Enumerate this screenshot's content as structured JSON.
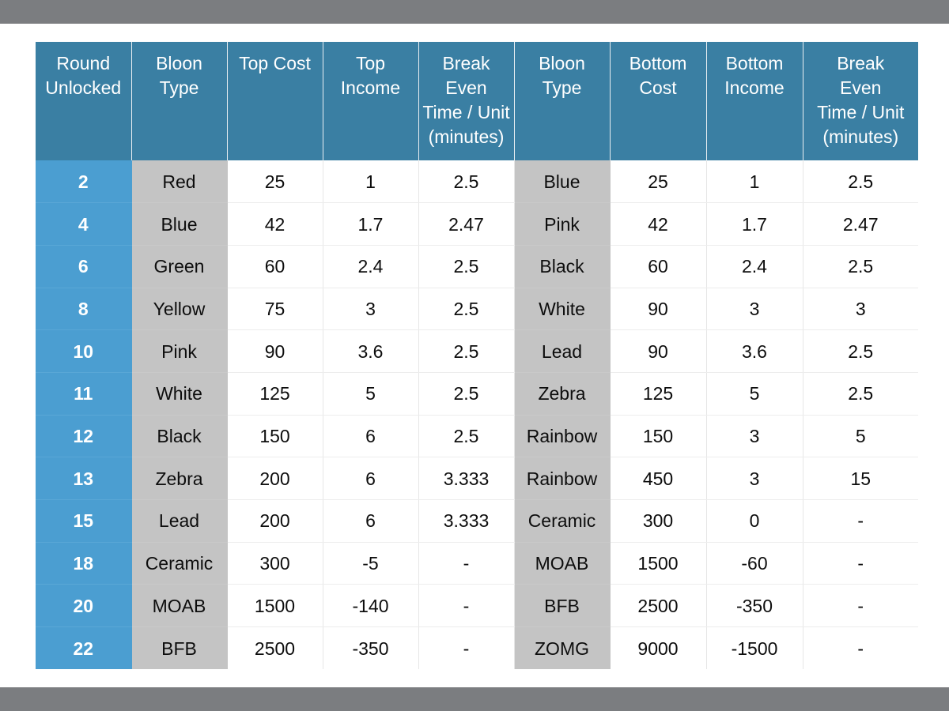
{
  "colors": {
    "header_blue": "#3a7fa3",
    "round_blue": "#4b9ed1",
    "bloon_gray": "#c4c4c4",
    "bar_gray": "#7b7d80",
    "cell_white": "#ffffff",
    "text_dark": "#0d0d0d",
    "text_light": "#ffffff"
  },
  "table": {
    "headers": [
      "Round Unlocked",
      "Bloon Type",
      "Top Cost",
      "Top Income",
      "Break Even Time / Unit (minutes)",
      "Bloon Type",
      "Bottom Cost",
      "Bottom Income",
      "Break Even Time / Unit (minutes)"
    ],
    "header_lines": [
      [
        "Round",
        "Unlocked"
      ],
      [
        "Bloon",
        "Type"
      ],
      [
        "Top Cost"
      ],
      [
        "Top",
        "Income"
      ],
      [
        "Break",
        "Even",
        "Time / Unit",
        "(minutes)"
      ],
      [
        "Bloon",
        "Type"
      ],
      [
        "Bottom",
        "Cost"
      ],
      [
        "Bottom",
        "Income"
      ],
      [
        "Break",
        "Even",
        "Time / Unit",
        "(minutes)"
      ]
    ],
    "rows": [
      [
        "2",
        "Red",
        "25",
        "1",
        "2.5",
        "Blue",
        "25",
        "1",
        "2.5"
      ],
      [
        "4",
        "Blue",
        "42",
        "1.7",
        "2.47",
        "Pink",
        "42",
        "1.7",
        "2.47"
      ],
      [
        "6",
        "Green",
        "60",
        "2.4",
        "2.5",
        "Black",
        "60",
        "2.4",
        "2.5"
      ],
      [
        "8",
        "Yellow",
        "75",
        "3",
        "2.5",
        "White",
        "90",
        "3",
        "3"
      ],
      [
        "10",
        "Pink",
        "90",
        "3.6",
        "2.5",
        "Lead",
        "90",
        "3.6",
        "2.5"
      ],
      [
        "11",
        "White",
        "125",
        "5",
        "2.5",
        "Zebra",
        "125",
        "5",
        "2.5"
      ],
      [
        "12",
        "Black",
        "150",
        "6",
        "2.5",
        "Rainbow",
        "150",
        "3",
        "5"
      ],
      [
        "13",
        "Zebra",
        "200",
        "6",
        "3.333",
        "Rainbow",
        "450",
        "3",
        "15"
      ],
      [
        "15",
        "Lead",
        "200",
        "6",
        "3.333",
        "Ceramic",
        "300",
        "0",
        "-"
      ],
      [
        "18",
        "Ceramic",
        "300",
        "-5",
        "-",
        "MOAB",
        "1500",
        "-60",
        "-"
      ],
      [
        "20",
        "MOAB",
        "1500",
        "-140",
        "-",
        "BFB",
        "2500",
        "-350",
        "-"
      ],
      [
        "22",
        "BFB",
        "2500",
        "-350",
        "-",
        "ZOMG",
        "9000",
        "-1500",
        "-"
      ]
    ]
  }
}
